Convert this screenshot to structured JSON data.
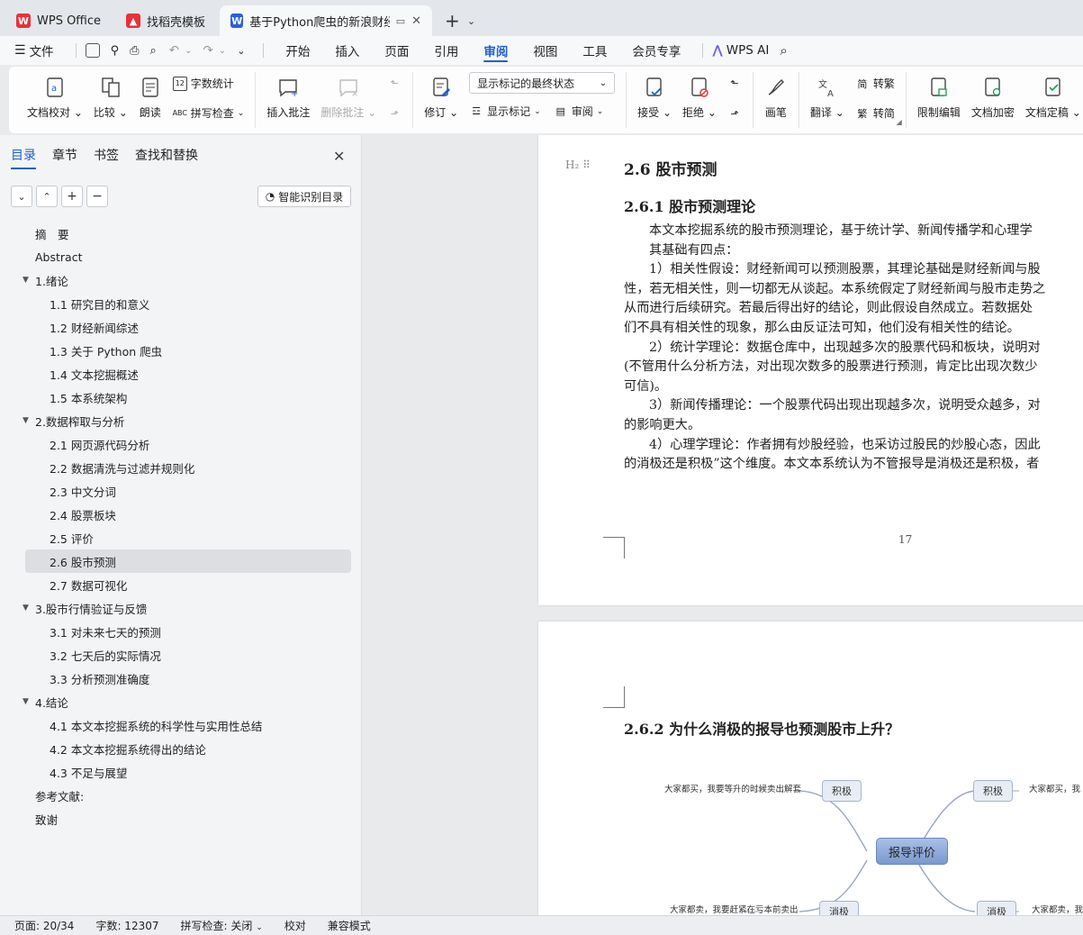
{
  "tabs": [
    {
      "label": "WPS Office",
      "icon": "wps-logo-icon",
      "color": "#e8313b"
    },
    {
      "label": "找稻壳模板",
      "icon": "docer-logo-icon",
      "color": "#e8313b"
    },
    {
      "label": "基于Python爬虫的新浪财经股",
      "icon": "writer-logo-icon",
      "color": "#2b5fd9"
    }
  ],
  "menu": {
    "file": "文件",
    "tabs": [
      "开始",
      "插入",
      "页面",
      "引用",
      "审阅",
      "视图",
      "工具",
      "会员专享"
    ],
    "active_tab": "审阅",
    "ai": "WPS AI"
  },
  "ribbon": {
    "doc_check": "文档校对",
    "compare": "比较",
    "read_aloud": "朗读",
    "word_count": "字数统计",
    "spell_check": "拼写检查",
    "insert_comment": "插入批注",
    "delete_comment": "删除批注",
    "track_changes": "修订",
    "markup_state": "显示标记的最终状态",
    "show_markup": "显示标记",
    "review": "审阅",
    "accept": "接受",
    "reject": "拒绝",
    "pen": "画笔",
    "translate": "翻译",
    "to_traditional": "转繁",
    "to_simplified": "转简",
    "restrict_edit": "限制编辑",
    "encrypt": "文档加密",
    "finalize": "文档定稿"
  },
  "sidebar": {
    "tabs": [
      "目录",
      "章节",
      "书签",
      "查找和替换"
    ],
    "active_tab": "目录",
    "smart_toc": "智能识别目录",
    "toc": [
      {
        "label": "摘　要",
        "level": 0
      },
      {
        "label": "Abstract",
        "level": 0
      },
      {
        "label": "1.绪论",
        "level": 0,
        "expanded": true
      },
      {
        "label": "1.1  研究目的和意义",
        "level": 1
      },
      {
        "label": "1.2  财经新闻综述",
        "level": 1
      },
      {
        "label": "1.3  关于 Python 爬虫",
        "level": 1
      },
      {
        "label": "1.4  文本挖掘概述",
        "level": 1
      },
      {
        "label": "1.5 本系统架构",
        "level": 1
      },
      {
        "label": "2.数据榨取与分析",
        "level": 0,
        "expanded": true
      },
      {
        "label": "2.1  网页源代码分析",
        "level": 1
      },
      {
        "label": "2.2  数据清洗与过滤并规则化",
        "level": 1
      },
      {
        "label": "2.3  中文分词",
        "level": 1
      },
      {
        "label": "2.4  股票板块",
        "level": 1
      },
      {
        "label": "2.5  评价",
        "level": 1
      },
      {
        "label": "2.6  股市预测",
        "level": 1,
        "selected": true
      },
      {
        "label": "2.7  数据可视化",
        "level": 1
      },
      {
        "label": "3.股市行情验证与反馈",
        "level": 0,
        "expanded": true
      },
      {
        "label": "3.1  对未来七天的预测",
        "level": 1
      },
      {
        "label": "3.2  七天后的实际情况",
        "level": 1
      },
      {
        "label": "3.3  分析预测准确度",
        "level": 1
      },
      {
        "label": "4.结论",
        "level": 0,
        "expanded": true
      },
      {
        "label": "4.1  本文本挖掘系统的科学性与实用性总结",
        "level": 1
      },
      {
        "label": "4.2  本文本挖掘系统得出的结论",
        "level": 1
      },
      {
        "label": "4.3  不足与展望",
        "level": 1
      },
      {
        "label": "参考文献:",
        "level": 0
      },
      {
        "label": "致谢",
        "level": 0
      }
    ]
  },
  "doc": {
    "heading_mark": "H₂",
    "h2": "2.6  股市预测",
    "h3a": "2.6.1  股市预测理论",
    "lines": [
      {
        "t": "本文本挖掘系统的股市预测理论，基于统计学、新闻传播学和心理学",
        "indent": true
      },
      {
        "t": "其基础有四点：",
        "indent": true
      },
      {
        "t": "1）相关性假设：财经新闻可以预测股票，其理论基础是财经新闻与股",
        "indent": true
      },
      {
        "t": "性，若无相关性，则一切都无从谈起。本系统假定了财经新闻与股市走势之",
        "indent": false
      },
      {
        "t": "从而进行后续研究。若最后得出好的结论，则此假设自然成立。若数据处",
        "indent": false
      },
      {
        "t": "们不具有相关性的现象，那么由反证法可知，他们没有相关性的结论。",
        "indent": false
      },
      {
        "t": "2）统计学理论：数据仓库中，出现越多次的股票代码和板块，说明对",
        "indent": true
      },
      {
        "t": "(不管用什么分析方法，对出现次数多的股票进行预测，肯定比出现次数少",
        "indent": false
      },
      {
        "t": "可信)。",
        "indent": false
      },
      {
        "t": "3）新闻传播理论：一个股票代码出现出现越多次，说明受众越多，对",
        "indent": true
      },
      {
        "t": "的影响更大。",
        "indent": false
      },
      {
        "t": "4）心理学理论：作者拥有炒股经验，也采访过股民的炒股心态，因此",
        "indent": true
      },
      {
        "t": "的消极还是积极”这个维度。本文本系统认为不管报导是消极还是积极，者",
        "indent": false
      }
    ],
    "page_number": "17",
    "h3b": "2.6.2  为什么消极的报导也预测股市上升？",
    "mindmap": {
      "center": "报导评价",
      "node_pos": "积极",
      "node_neg": "消极",
      "leaf_tl": "大家都买，我要等升的时候卖出解套",
      "leaf_tr": "大家都买，我",
      "leaf_bl": "大家都卖，我要赶紧在亏本前卖出",
      "leaf_br": "大家都卖，我"
    }
  },
  "status": {
    "page": "页面: 20/34",
    "words": "字数: 12307",
    "spell": "拼写检查: 关闭",
    "proof": "校对",
    "compat": "兼容模式"
  }
}
